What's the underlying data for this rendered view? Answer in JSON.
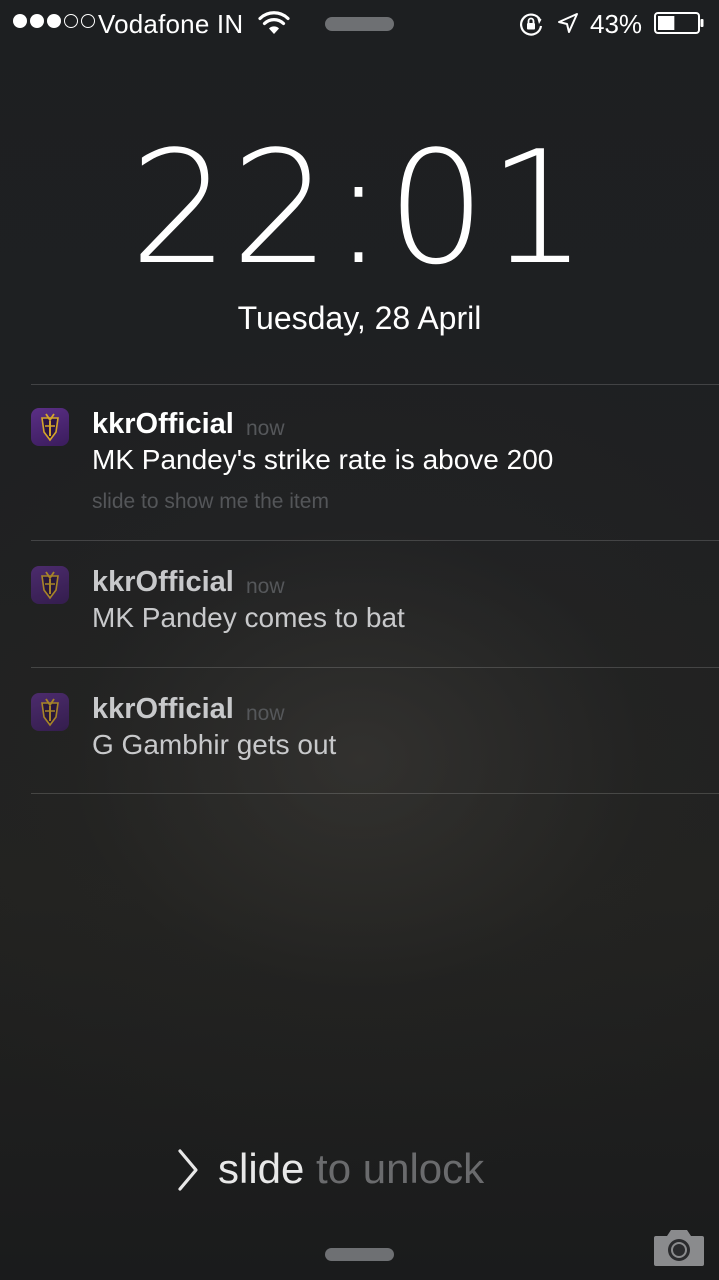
{
  "status_bar": {
    "carrier": "Vodafone IN",
    "signal_bars_filled": 3,
    "signal_bars_total": 5,
    "battery_percent": "43%",
    "battery_level": 0.43
  },
  "lock_screen": {
    "time": "22:01",
    "date": "Tuesday, 28 April",
    "slide_prefix": "slide",
    "slide_rest": " to unlock"
  },
  "notifications": [
    {
      "app": "kkrOfficial",
      "time": "now",
      "message": "MK Pandey's strike rate is above 200",
      "hint": "slide to show me the item"
    },
    {
      "app": "kkrOfficial",
      "time": "now",
      "message": "MK Pandey comes to bat",
      "hint": ""
    },
    {
      "app": "kkrOfficial",
      "time": "now",
      "message": "G Gambhir gets out",
      "hint": ""
    }
  ],
  "colors": {
    "app_icon_purple": "#4a2470",
    "app_icon_gold": "#d4a52a"
  },
  "icons": {
    "wifi": "wifi-icon",
    "rotation_lock": "rotation-lock-icon",
    "location": "location-arrow-icon",
    "battery": "battery-icon",
    "app": "kkr-logo-icon",
    "chevron": "chevron-right-icon",
    "camera": "camera-icon"
  }
}
